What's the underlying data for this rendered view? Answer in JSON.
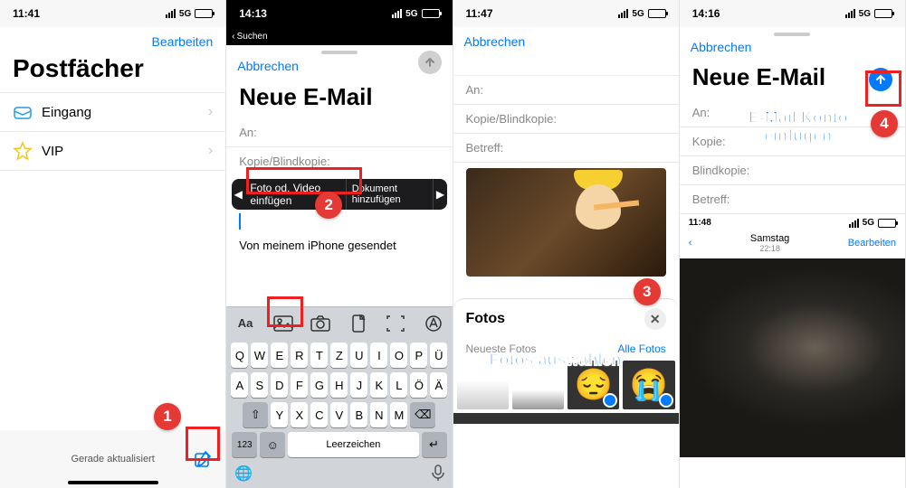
{
  "status": {
    "t1": "11:41",
    "t2": "14:13",
    "t3": "11:47",
    "t4": "14:16",
    "net": "5G"
  },
  "p1": {
    "edit": "Bearbeiten",
    "title": "Postfächer",
    "inbox": "Eingang",
    "vip": "VIP",
    "updated": "Gerade aktualisiert"
  },
  "p2": {
    "back_search": "Suchen",
    "cancel": "Abbrechen",
    "title": "Neue E-Mail",
    "to": "An:",
    "ccbcc": "Kopie/Blindkopie:",
    "popover_insert": "Foto od. Video einfügen",
    "popover_doc": "Dokument hinzufügen",
    "signature": "Von meinem iPhone gesendet",
    "kb": {
      "aa": "Aa",
      "row1": [
        "Q",
        "W",
        "E",
        "R",
        "T",
        "Z",
        "U",
        "I",
        "O",
        "P",
        "Ü"
      ],
      "row2": [
        "A",
        "S",
        "D",
        "F",
        "G",
        "H",
        "J",
        "K",
        "L",
        "Ö",
        "Ä"
      ],
      "row3": [
        "Y",
        "X",
        "C",
        "V",
        "B",
        "N",
        "M"
      ],
      "numkey": "123",
      "space": "Leerzeichen",
      "return": "↵"
    }
  },
  "p3": {
    "cancel": "Abbrechen",
    "to": "An:",
    "ccbcc": "Kopie/Blindkopie:",
    "subject": "Betreff:",
    "photos_title": "Fotos",
    "recent": "Neueste Fotos",
    "all": "Alle Fotos"
  },
  "p4": {
    "cancel": "Abbrechen",
    "title": "Neue E-Mail",
    "to": "An:",
    "cc": "Kopie:",
    "bcc": "Blindkopie:",
    "subject": "Betreff:",
    "ss_time": "11:48",
    "ss_day": "Samstag",
    "ss_date": "22:18",
    "ss_edit": "Bearbeiten"
  },
  "anno": {
    "n1": "1",
    "n2": "2",
    "n3": "3",
    "n4": "4",
    "t3": "Fotos auswählen",
    "t4a": "E-Mail Konto",
    "t4b": "einfügen"
  }
}
